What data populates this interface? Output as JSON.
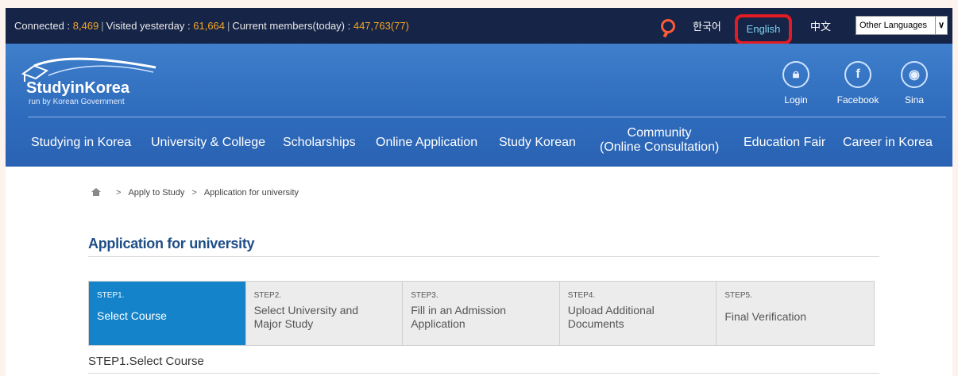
{
  "topbar": {
    "connected_label": "Connected : ",
    "connected_value": "8,469",
    "visited_label": "Visited yesterday : ",
    "visited_value": "61,664",
    "members_label": "Current members(today) : ",
    "members_value": "447,763(77)",
    "languages": {
      "korean": "한국어",
      "english": "English",
      "chinese": "中文"
    },
    "other_languages": "Other Languages"
  },
  "header": {
    "logo_text": "StudyinKorea",
    "logo_sub": "run by Korean Government",
    "buttons": {
      "login": "Login",
      "facebook": "Facebook",
      "sina": "Sina"
    }
  },
  "nav": {
    "items": [
      "Studying in Korea",
      "University & College",
      "Scholarships",
      "Online Application",
      "Study Korean",
      "Community",
      "Education Fair",
      "Career in Korea"
    ],
    "community_sub": "(Online Consultation)"
  },
  "breadcrumb": {
    "items": [
      "Apply to Study",
      "Application for university"
    ],
    "separator": ">"
  },
  "page": {
    "title": "Application for university",
    "steps": [
      {
        "num": "STEP1.",
        "label": "Select Course"
      },
      {
        "num": "STEP2.",
        "label_1": "Select University and",
        "label_2": "Major Study"
      },
      {
        "num": "STEP3.",
        "label_1": "Fill in an Admission",
        "label_2": "Application"
      },
      {
        "num": "STEP4.",
        "label_1": "Upload Additional",
        "label_2": "Documents"
      },
      {
        "num": "STEP5.",
        "label": "Final Verification"
      }
    ],
    "current_step_title": "STEP1.Select Course"
  },
  "colors": {
    "topbar_bg": "#162447",
    "accent_orange": "#f5a623",
    "header_blue": "#2f6cbd",
    "active_step": "#1483c9",
    "highlight_red": "#e31b23",
    "title_blue": "#1f4e87"
  }
}
